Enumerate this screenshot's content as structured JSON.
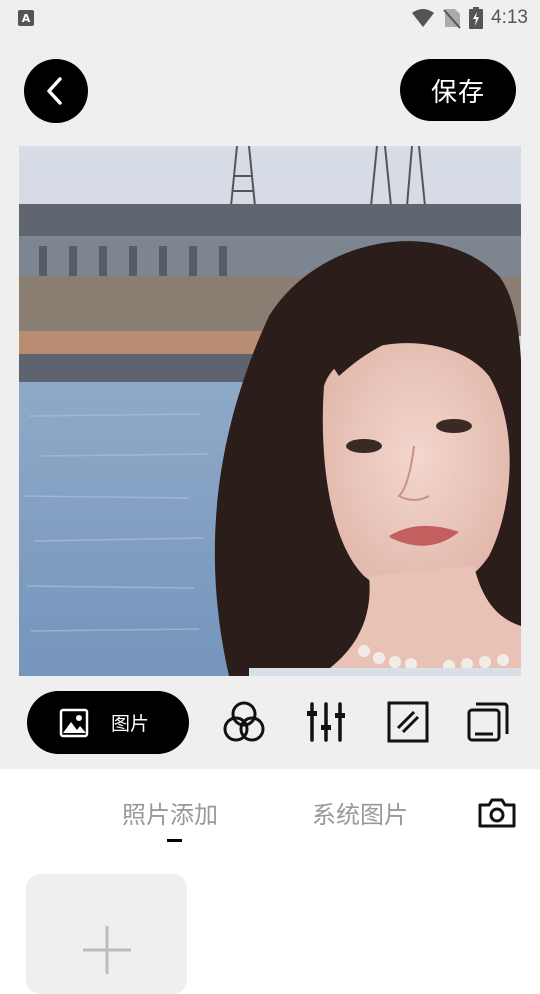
{
  "status_bar": {
    "time": "4:13",
    "notification_icon_label": "A",
    "icons": [
      "wifi-icon",
      "no-sim-icon",
      "battery-charging-icon"
    ]
  },
  "header": {
    "back_icon": "chevron-left-icon",
    "save_label": "保存"
  },
  "toolbar": {
    "image_label": "图片",
    "tools": [
      "image-icon",
      "filter-circles-icon",
      "adjust-sliders-icon",
      "texture-icon",
      "layers-icon"
    ]
  },
  "panel": {
    "tabs": [
      {
        "label": "照片添加",
        "active": true
      },
      {
        "label": "系统图片",
        "active": false
      }
    ],
    "camera_icon": "camera-icon",
    "add_tile_icon": "plus-icon"
  },
  "colors": {
    "bar_bg": "#efefef",
    "accent": "#000000",
    "inactive_text": "#999999"
  }
}
